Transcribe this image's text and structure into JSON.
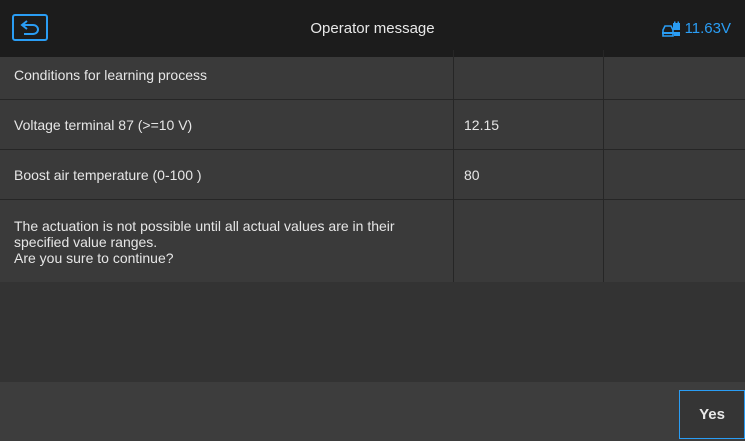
{
  "header": {
    "back_icon": "back-arrow-icon",
    "title": "Operator message",
    "battery_icon": "vehicle-battery-icon",
    "voltage": "11.63V",
    "accent_color": "#2a9df4"
  },
  "table": {
    "rows": [
      {
        "label": "Conditions for learning process",
        "value": "",
        "extra": ""
      },
      {
        "label": "Voltage terminal 87 (>=10 V)",
        "value": "12.15",
        "extra": ""
      },
      {
        "label": "Boost air temperature (0-100 )",
        "value": "80",
        "extra": ""
      },
      {
        "label": "The actuation is not possible until all actual values are in their\nspecified value ranges.\nAre you sure to continue?",
        "value": "",
        "extra": ""
      }
    ]
  },
  "footer": {
    "yes_label": "Yes"
  }
}
